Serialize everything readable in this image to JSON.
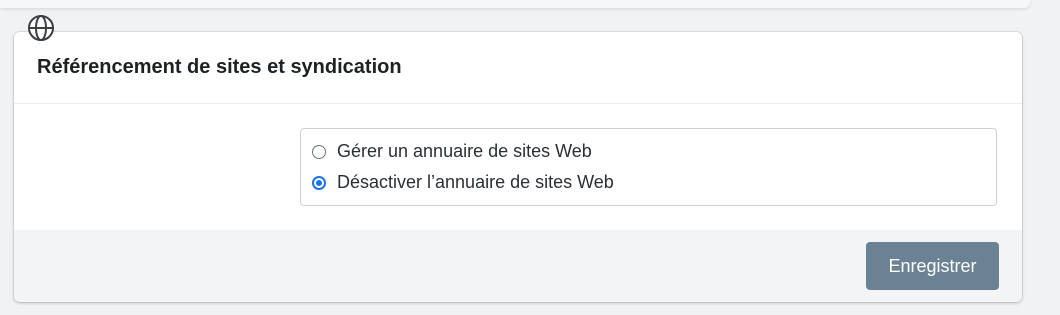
{
  "header_icon": "globe-icon",
  "card": {
    "title": "Référencement de sites et syndication"
  },
  "options": [
    {
      "label": "Gérer un annuaire de sites Web",
      "checked": false
    },
    {
      "label": "Désactiver l’annuaire de sites Web",
      "checked": true
    }
  ],
  "footer": {
    "save_label": "Enregistrer"
  },
  "colors": {
    "accent": "#1a73e8",
    "save_button": "#6b8194",
    "footer_bg": "#f3f4f6",
    "page_bg": "#f1f2f4"
  }
}
